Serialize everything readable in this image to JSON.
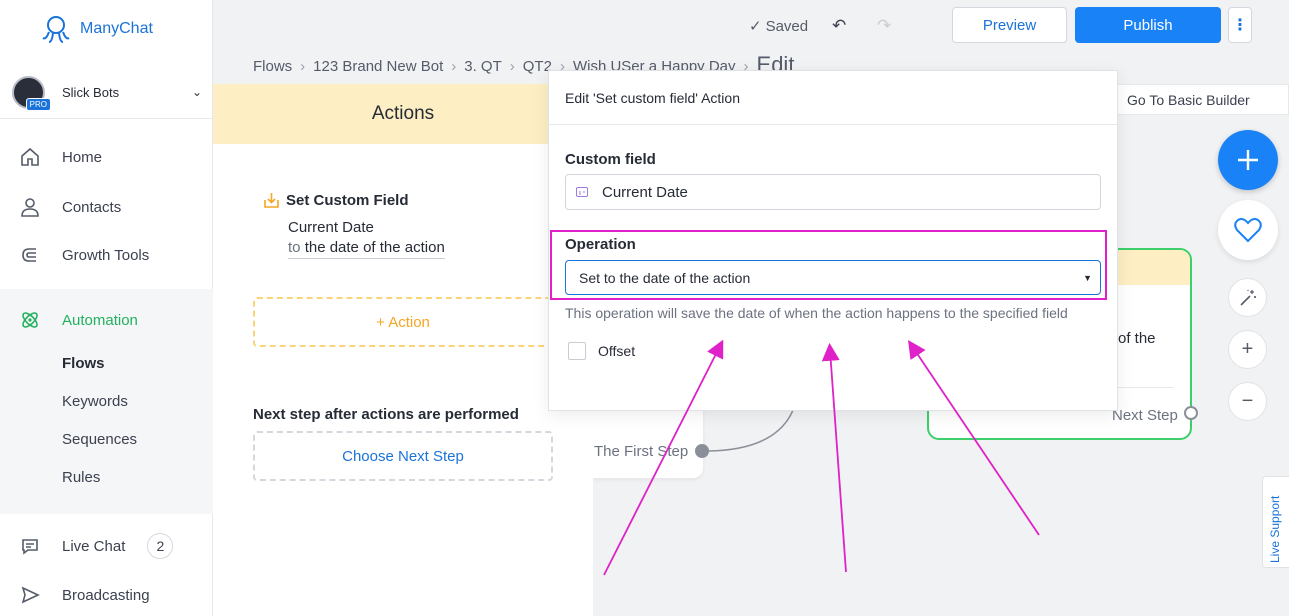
{
  "app": {
    "name": "ManyChat"
  },
  "account": {
    "name": "Slick Bots",
    "badge": "PRO"
  },
  "nav": {
    "home": "Home",
    "contacts": "Contacts",
    "growth_tools": "Growth Tools",
    "automation": "Automation",
    "flows": "Flows",
    "keywords": "Keywords",
    "sequences": "Sequences",
    "rules": "Rules",
    "live_chat": "Live Chat",
    "live_chat_count": "2",
    "broadcasting": "Broadcasting"
  },
  "toolbar": {
    "saved": "Saved",
    "preview": "Preview",
    "publish": "Publish"
  },
  "breadcrumb": [
    "Flows",
    "123 Brand New Bot",
    "3. QT",
    "QT2",
    "Wish USer a Happy Day",
    "Edit"
  ],
  "basic_builder": "Go To Basic Builder",
  "actions_panel": {
    "title": "Actions",
    "item_title": "Set Custom Field",
    "item_field": "Current Date",
    "item_to": "to",
    "item_value": "the date of the action",
    "add_action": "+ Action",
    "next_step_label": "Next step after actions are performed",
    "choose_next": "Choose Next Step"
  },
  "modal": {
    "title": "Edit 'Set custom field' Action",
    "custom_field_label": "Custom field",
    "custom_field_value": "Current Date",
    "operation_label": "Operation",
    "operation_value": "Set to the date of the action",
    "operation_help": "This operation will save the date of when the action happens to the specified field",
    "offset_label": "Offset"
  },
  "canvas": {
    "first_step": "The First Step",
    "node_text": "of the",
    "next_step": "Next Step"
  },
  "live_support": "Live Support",
  "colors": {
    "accent": "#1a82f7",
    "highlight": "#e020c8",
    "automation": "#21b15e"
  }
}
